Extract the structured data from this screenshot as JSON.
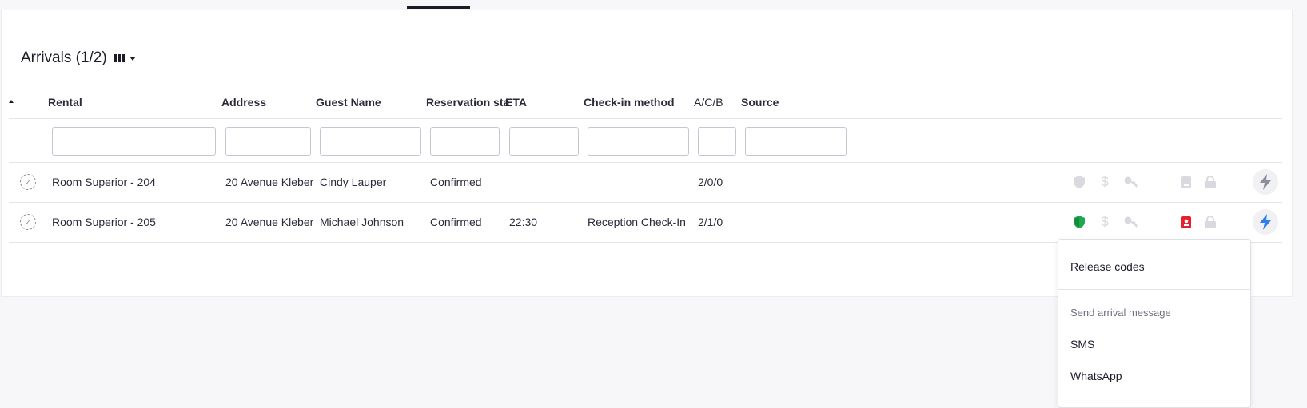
{
  "header": {
    "title": "Arrivals (1/2)"
  },
  "columns": [
    "Rental",
    "Address",
    "Guest Name",
    "Reservation sta",
    "ETA",
    "Check-in method",
    "A/C/B",
    "Source"
  ],
  "rows": [
    {
      "rental": "Room Superior - 204",
      "address": "20 Avenue Kleber",
      "guest": "Cindy Lauper",
      "status": "Confirmed",
      "eta": "",
      "checkin": "",
      "acb": "2/0/0",
      "source": ""
    },
    {
      "rental": "Room Superior - 205",
      "address": "20 Avenue Kleber",
      "guest": "Michael Johnson",
      "status": "Confirmed",
      "eta": "22:30",
      "checkin": "Reception Check-In",
      "acb": "2/1/0",
      "source": ""
    }
  ],
  "row_icons": [
    {
      "shield": "shield-icon",
      "dollar": "$",
      "key": "key-icon",
      "card": "id-card-icon",
      "lock": "lock-icon",
      "bolt": "bolt-icon"
    },
    {
      "shield": "shield-icon",
      "dollar": "$",
      "key": "key-icon",
      "card": "id-card-icon",
      "lock": "lock-icon",
      "bolt": "bolt-icon"
    }
  ],
  "colors": {
    "shield_active": "#1fa84f",
    "card_active": "#e5202e",
    "bolt_active": "#2f80ed",
    "icon_inactive": "#d9d9df"
  },
  "menu": {
    "release_codes": "Release codes",
    "section_label": "Send arrival message",
    "sms": "SMS",
    "whatsapp": "WhatsApp"
  }
}
